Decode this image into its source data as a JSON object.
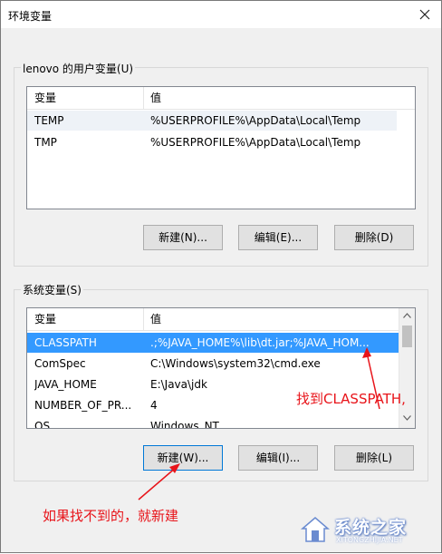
{
  "window": {
    "title": "环境变量",
    "close_icon": "close-icon"
  },
  "user_vars": {
    "group_label": "lenovo 的用户变量(U)",
    "columns": [
      "变量",
      "值"
    ],
    "rows": [
      {
        "name": "TEMP",
        "value": "%USERPROFILE%\\AppData\\Local\\Temp"
      },
      {
        "name": "TMP",
        "value": "%USERPROFILE%\\AppData\\Local\\Temp"
      }
    ],
    "buttons": {
      "new": "新建(N)...",
      "edit": "编辑(E)...",
      "delete": "删除(D)"
    }
  },
  "system_vars": {
    "group_label": "系统变量(S)",
    "columns": [
      "变量",
      "值"
    ],
    "rows": [
      {
        "name": "CLASSPATH",
        "value": ".;%JAVA_HOME%\\lib\\dt.jar;%JAVA_HOM..."
      },
      {
        "name": "ComSpec",
        "value": "C:\\Windows\\system32\\cmd.exe"
      },
      {
        "name": "JAVA_HOME",
        "value": "E:\\Java\\jdk"
      },
      {
        "name": "NUMBER_OF_PR...",
        "value": "4"
      },
      {
        "name": "OS",
        "value": "Windows_NT"
      }
    ],
    "buttons": {
      "new": "新建(W)...",
      "edit": "编辑(I)...",
      "delete": "删除(L)"
    }
  },
  "annotations": {
    "find_classpath": "找到CLASSPATH,",
    "create_if_missing": "如果找不到的，就新建"
  },
  "watermark": {
    "text": "系统之家",
    "sub": "XITONGZHIJIA.NET"
  },
  "colors": {
    "selection": "#3399ff",
    "annotation": "#e8141a",
    "focus_border": "#0078d7"
  }
}
